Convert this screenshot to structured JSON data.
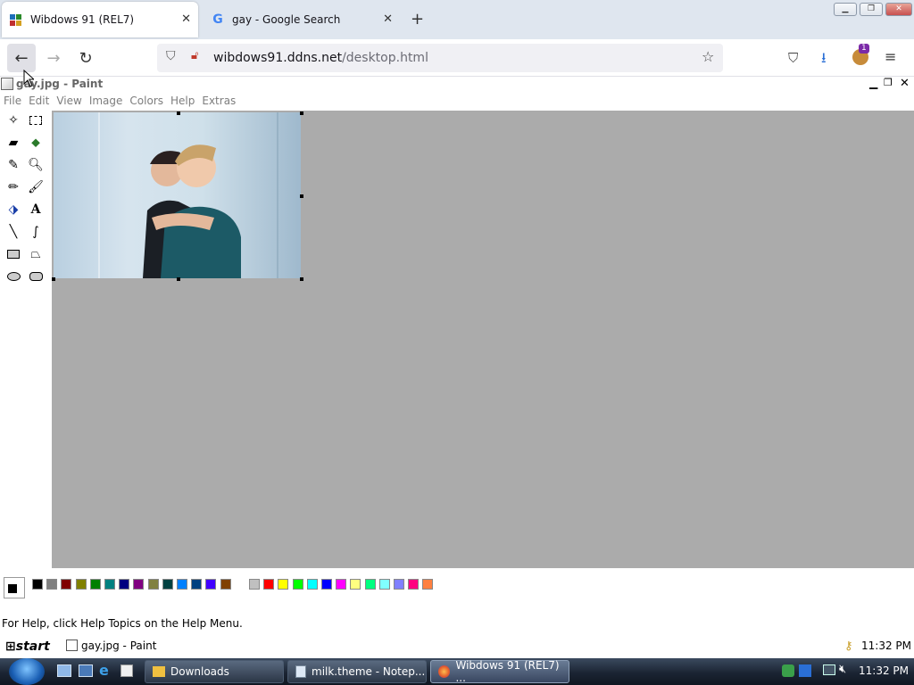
{
  "browser": {
    "tabs": [
      {
        "label": "Wibdows 91 (REL7)"
      },
      {
        "label": "gay - Google Search"
      }
    ],
    "url_domain": "wibdows91.ddns.net",
    "url_path": "/desktop.html",
    "ext_badge": "1"
  },
  "paint": {
    "title": "gay.jpg - Paint",
    "menus": [
      "File",
      "Edit",
      "View",
      "Image",
      "Colors",
      "Help",
      "Extras"
    ],
    "status": "For Help, click Help Topics on the Help Menu.",
    "palette": [
      "#000000",
      "#808080",
      "#800000",
      "#808000",
      "#008000",
      "#008080",
      "#000080",
      "#800080",
      "#808040",
      "#004040",
      "#0080ff",
      "#004080",
      "#4000ff",
      "#804000",
      "#ffffff",
      "#c0c0c0",
      "#ff0000",
      "#ffff00",
      "#00ff00",
      "#00ffff",
      "#0000ff",
      "#ff00ff",
      "#ffff80",
      "#00ff80",
      "#80ffff",
      "#8080ff",
      "#ff0080",
      "#ff8040"
    ],
    "fg_color": "#000000",
    "bg_color": "#ffffff"
  },
  "w91_taskbar": {
    "start": "start",
    "item": "gay.jpg - Paint",
    "clock": "11:32 PM"
  },
  "win7_taskbar": {
    "items": [
      "Downloads",
      "milk.theme - Notep...",
      "Wibdows 91 (REL7) ..."
    ],
    "clock": "11:32 PM"
  }
}
